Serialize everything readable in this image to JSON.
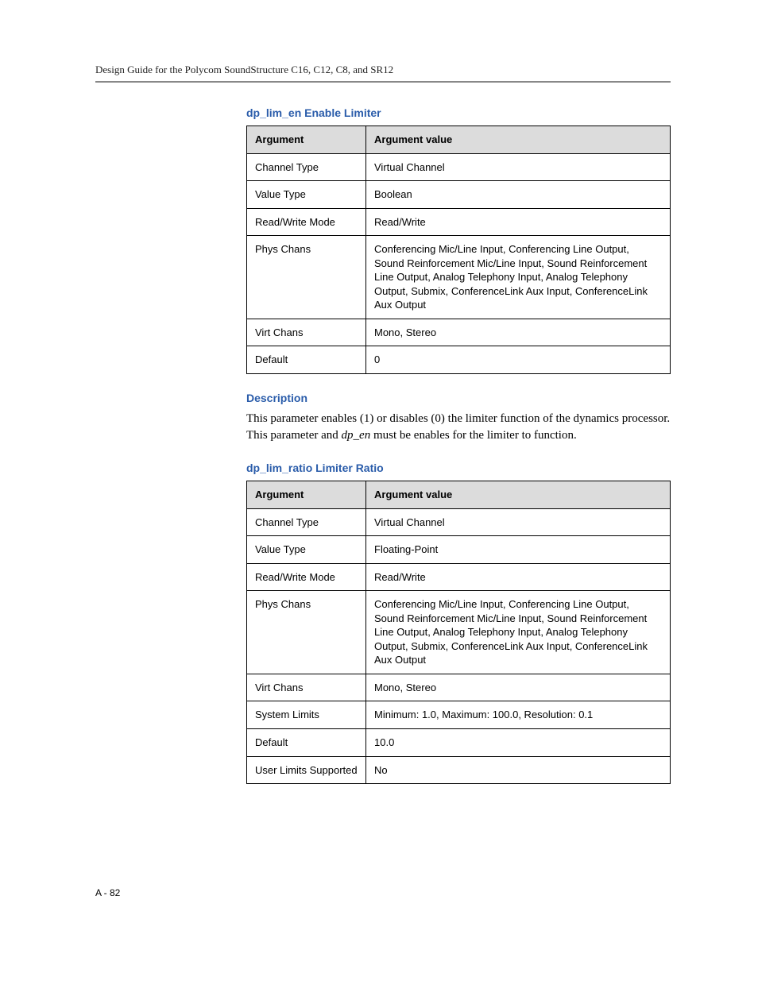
{
  "header": {
    "title": "Design Guide for the Polycom SoundStructure C16, C12, C8, and SR12"
  },
  "sections": {
    "s1": {
      "title": "dp_lim_en Enable Limiter",
      "th_argument": "Argument",
      "th_value": "Argument value",
      "rows": {
        "r0": {
          "arg": "Channel Type",
          "val": "Virtual Channel"
        },
        "r1": {
          "arg": "Value Type",
          "val": "Boolean"
        },
        "r2": {
          "arg": "Read/Write Mode",
          "val": "Read/Write"
        },
        "r3": {
          "arg": "Phys Chans",
          "val": "Conferencing Mic/Line Input, Conferencing Line Output, Sound Reinforcement Mic/Line Input, Sound Reinforcement Line Output, Analog Telephony Input, Analog Telephony Output, Submix, ConferenceLink Aux Input, ConferenceLink Aux Output"
        },
        "r4": {
          "arg": "Virt Chans",
          "val": "Mono, Stereo"
        },
        "r5": {
          "arg": "Default",
          "val": "0"
        }
      }
    },
    "desc": {
      "title": "Description",
      "text_before": "This parameter enables (1) or disables (0) the limiter function of the dynamics processor. This parameter and ",
      "emph": "dp_en",
      "text_after": " must be enables for the limiter to function."
    },
    "s2": {
      "title": "dp_lim_ratio Limiter Ratio",
      "th_argument": "Argument",
      "th_value": "Argument value",
      "rows": {
        "r0": {
          "arg": "Channel Type",
          "val": "Virtual Channel"
        },
        "r1": {
          "arg": "Value Type",
          "val": "Floating-Point"
        },
        "r2": {
          "arg": "Read/Write Mode",
          "val": "Read/Write"
        },
        "r3": {
          "arg": "Phys Chans",
          "val": "Conferencing Mic/Line Input, Conferencing Line Output, Sound Reinforcement Mic/Line Input, Sound Reinforcement Line Output, Analog Telephony Input, Analog Telephony Output, Submix, ConferenceLink Aux Input, ConferenceLink Aux Output"
        },
        "r4": {
          "arg": "Virt Chans",
          "val": "Mono, Stereo"
        },
        "r5": {
          "arg": "System Limits",
          "val": "Minimum: 1.0, Maximum: 100.0, Resolution: 0.1"
        },
        "r6": {
          "arg": "Default",
          "val": "10.0"
        },
        "r7": {
          "arg": "User Limits Supported",
          "val": "No"
        }
      }
    }
  },
  "footer": {
    "page_number": "A - 82"
  }
}
